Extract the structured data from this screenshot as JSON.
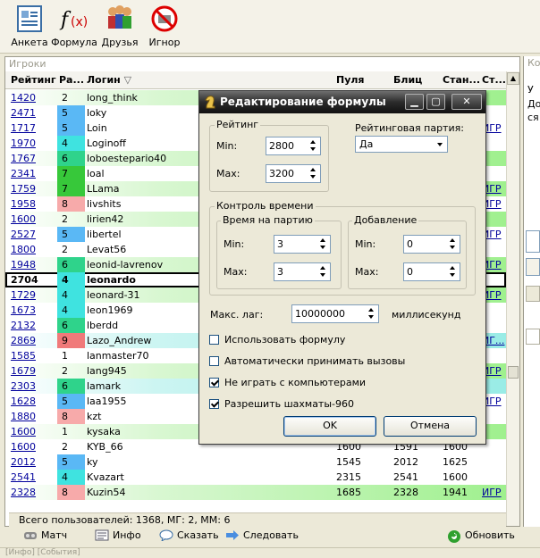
{
  "toolbar": {
    "items": [
      {
        "label": "Анкета",
        "icon": "profile-form-icon"
      },
      {
        "label": "Формула",
        "icon": "formula-icon"
      },
      {
        "label": "Друзья",
        "icon": "friends-icon"
      },
      {
        "label": "Игнор",
        "icon": "ignore-icon"
      }
    ]
  },
  "players": {
    "panel_title": "Игроки",
    "columns": [
      "Рейтинг",
      "Ра...",
      "Логин",
      "Пуля",
      "Блиц",
      "Стан...",
      "Ст..."
    ],
    "rows": [
      {
        "rating": "1420",
        "rank": "2",
        "login": "long_think",
        "pula": "",
        "blitz": "",
        "stan": "",
        "st": "",
        "bg": "g",
        "rank_color": ""
      },
      {
        "rating": "2471",
        "rank": "5",
        "login": "loky",
        "pula": "",
        "blitz": "",
        "stan": "",
        "st": "",
        "bg": "",
        "rank_color": "#5ab8f5"
      },
      {
        "rating": "1717",
        "rank": "5",
        "login": "Loin",
        "pula": "",
        "blitz": "",
        "stan": "",
        "st": "ИГР",
        "bg": "",
        "rank_color": "#5ab8f5"
      },
      {
        "rating": "1970",
        "rank": "4",
        "login": "Loginoff",
        "pula": "",
        "blitz": "",
        "stan": "",
        "st": "",
        "bg": "",
        "rank_color": "#3fe3e0"
      },
      {
        "rating": "1767",
        "rank": "6",
        "login": "loboestepario40",
        "pula": "",
        "blitz": "",
        "stan": "",
        "st": "",
        "bg": "g",
        "rank_color": "#2fd38b"
      },
      {
        "rating": "2341",
        "rank": "7",
        "login": "loal",
        "pula": "",
        "blitz": "",
        "stan": "",
        "st": "",
        "bg": "",
        "rank_color": "#37c83a"
      },
      {
        "rating": "1759",
        "rank": "7",
        "login": "LLama",
        "pula": "",
        "blitz": "",
        "stan": "",
        "st": "ИГР",
        "bg": "g",
        "rank_color": "#37c83a"
      },
      {
        "rating": "1958",
        "rank": "8",
        "login": "livshits",
        "pula": "",
        "blitz": "",
        "stan": "",
        "st": "ИГР",
        "bg": "",
        "rank_color": "#f7aaaa"
      },
      {
        "rating": "1600",
        "rank": "2",
        "login": "lirien42",
        "pula": "",
        "blitz": "",
        "stan": "",
        "st": "",
        "bg": "g",
        "rank_color": ""
      },
      {
        "rating": "2527",
        "rank": "5",
        "login": "libertel",
        "pula": "",
        "blitz": "",
        "stan": "",
        "st": "ИГР",
        "bg": "",
        "rank_color": "#5ab8f5"
      },
      {
        "rating": "1800",
        "rank": "2",
        "login": "Levat56",
        "pula": "",
        "blitz": "",
        "stan": "",
        "st": "",
        "bg": "",
        "rank_color": ""
      },
      {
        "rating": "1948",
        "rank": "6",
        "login": "leonid-lavrenov",
        "pula": "",
        "blitz": "",
        "stan": "",
        "st": "ИГР",
        "bg": "g",
        "rank_color": "#2fd38b"
      },
      {
        "rating": "2704",
        "rank": "4",
        "login": "leonardo",
        "pula": "",
        "blitz": "",
        "stan": "",
        "st": "",
        "bg": "sel",
        "rank_color": "#3fe3e0"
      },
      {
        "rating": "1729",
        "rank": "4",
        "login": "leonard-31",
        "pula": "",
        "blitz": "",
        "stan": "",
        "st": "ИГР",
        "bg": "g",
        "rank_color": "#3fe3e0"
      },
      {
        "rating": "1673",
        "rank": "4",
        "login": "leon1969",
        "pula": "",
        "blitz": "",
        "stan": "",
        "st": "",
        "bg": "",
        "rank_color": "#3fe3e0"
      },
      {
        "rating": "2132",
        "rank": "6",
        "login": "lberdd",
        "pula": "",
        "blitz": "",
        "stan": "",
        "st": "",
        "bg": "",
        "rank_color": "#2fd38b"
      },
      {
        "rating": "2869",
        "rank": "9",
        "login": "Lazo_Andrew",
        "pula": "",
        "blitz": "",
        "stan": "",
        "st": "ИГ...",
        "bg": "c",
        "rank_color": "#f07a7a"
      },
      {
        "rating": "1585",
        "rank": "1",
        "login": "lanmaster70",
        "pula": "",
        "blitz": "",
        "stan": "",
        "st": "",
        "bg": "",
        "rank_color": ""
      },
      {
        "rating": "1679",
        "rank": "2",
        "login": "lang945",
        "pula": "",
        "blitz": "",
        "stan": "",
        "st": "ИГР",
        "bg": "g",
        "rank_color": ""
      },
      {
        "rating": "2303",
        "rank": "6",
        "login": "lamark",
        "pula": "",
        "blitz": "",
        "stan": "",
        "st": "",
        "bg": "c",
        "rank_color": "#2fd38b"
      },
      {
        "rating": "1628",
        "rank": "5",
        "login": "laa1955",
        "pula": "",
        "blitz": "",
        "stan": "",
        "st": "ИГР",
        "bg": "",
        "rank_color": "#5ab8f5"
      },
      {
        "rating": "1880",
        "rank": "8",
        "login": "kzt",
        "pula": "",
        "blitz": "",
        "stan": "",
        "st": "",
        "bg": "",
        "rank_color": "#f7aaaa"
      },
      {
        "rating": "1600",
        "rank": "1",
        "login": "kysaka",
        "pula": "",
        "blitz": "",
        "stan": "",
        "st": "",
        "bg": "g",
        "rank_color": ""
      },
      {
        "rating": "1600",
        "rank": "2",
        "login": "KYB_66",
        "pula": "1600",
        "blitz": "1591",
        "stan": "1600",
        "st": "",
        "bg": "",
        "rank_color": ""
      },
      {
        "rating": "2012",
        "rank": "5",
        "login": "ky",
        "pula": "1545",
        "blitz": "2012",
        "stan": "1625",
        "st": "",
        "bg": "",
        "rank_color": "#5ab8f5"
      },
      {
        "rating": "2541",
        "rank": "4",
        "login": "Kvazart",
        "pula": "2315",
        "blitz": "2541",
        "stan": "1600",
        "st": "",
        "bg": "",
        "rank_color": "#3fe3e0"
      },
      {
        "rating": "2328",
        "rank": "8",
        "login": "Kuzin54",
        "pula": "1685",
        "blitz": "2328",
        "stan": "1941",
        "st": "ИГР",
        "bg": "g",
        "rank_color": "#f7aaaa"
      }
    ],
    "status": "Всего пользователей: 1368, МГ: 2, ММ: 6"
  },
  "actions": {
    "match": "Матч",
    "info": "Инфо",
    "say": "Сказать",
    "follow": "Следовать",
    "refresh": "Обновить"
  },
  "bottom_tabs": "[Инфо] [События]",
  "right_panel": {
    "title": "Конт",
    "lines": [
      "У",
      "До",
      "ся"
    ]
  },
  "dialog": {
    "title": "Редактирование формулы",
    "rating_group": "Рейтинг",
    "rating_min_label": "Min:",
    "rating_min": "2800",
    "rating_max_label": "Max:",
    "rating_max": "3200",
    "rated_game_label": "Рейтинговая партия:",
    "rated_game_value": "Да",
    "time_control_group": "Контроль времени",
    "time_per_game_group": "Время на партию",
    "time_min_label": "Min:",
    "time_min": "3",
    "time_max_label": "Max:",
    "time_max": "3",
    "increment_group": "Добавление",
    "inc_min_label": "Min:",
    "inc_min": "0",
    "inc_max_label": "Max:",
    "inc_max": "0",
    "max_lag_label": "Макс. лаг:",
    "max_lag": "10000000",
    "max_lag_unit": "миллисекунд",
    "opt_use_formula": "Использовать формулу",
    "opt_auto_accept": "Автоматически принимать вызовы",
    "opt_no_computers": "Не играть с компьютерами",
    "opt_chess960": "Разрешить шахматы-960",
    "ok_label": "OK",
    "cancel_label": "Отмена"
  }
}
